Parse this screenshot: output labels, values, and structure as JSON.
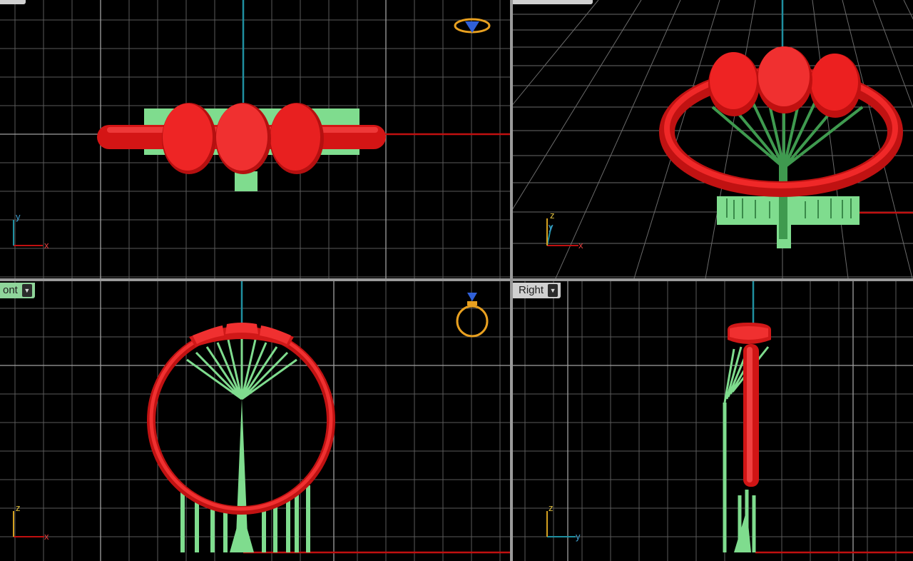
{
  "viewports": {
    "top": {
      "tab_label": "",
      "axis_x": "x",
      "axis_y": "y"
    },
    "perspective": {
      "tab_label": "",
      "axis_x": "x",
      "axis_y": "y",
      "axis_z": "z"
    },
    "front": {
      "tab_label": "ont",
      "axis_x": "x",
      "axis_z": "z"
    },
    "right": {
      "tab_label": "Right",
      "axis_y": "y",
      "axis_z": "z"
    }
  },
  "colors": {
    "background": "#000000",
    "grid_minor": "#5a5a5a",
    "grid_major": "#9a9a9a",
    "ring_red": "#e31b1b",
    "support_green": "#7fdc8e",
    "axis_x_red": "#c01010",
    "axis_vertical_teal": "#1f8fa0",
    "gizmo_gold": "#e8a020",
    "gizmo_blue": "#3060d8",
    "tab_green": "#8fd49a",
    "tab_gray": "#d0d0d0"
  },
  "icons": {
    "top_ring_gizmo": "ring-top-gizmo-icon",
    "front_ring_gizmo": "ring-front-gizmo-icon",
    "dropdown": "triangle-down-icon"
  }
}
